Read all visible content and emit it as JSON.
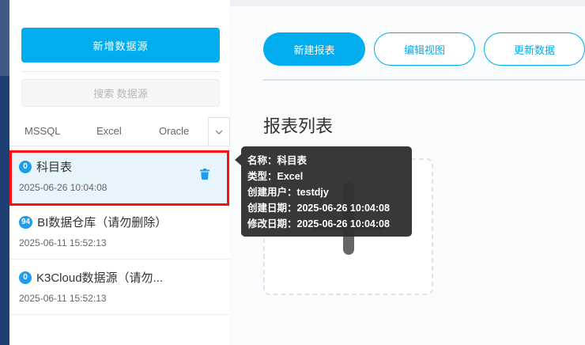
{
  "sidebar": {
    "add_button": "新增数据源",
    "search_placeholder": "搜索 数据源",
    "tabs": [
      "MSSQL",
      "Excel",
      "Oracle"
    ],
    "tab_more_icon": "chevron-down-icon",
    "items": [
      {
        "badge": "0",
        "name": "科目表",
        "date": "2025-06-26 10:04:08",
        "active": true
      },
      {
        "badge": "94",
        "name": "BI数据仓库（请勿删除）",
        "date": "2025-06-11 15:52:13",
        "active": false
      },
      {
        "badge": "0",
        "name": "K3Cloud数据源（请勿...",
        "date": "2025-06-11 15:52:13",
        "active": false
      }
    ]
  },
  "toolbar": {
    "new_report": "新建报表",
    "edit_view": "编辑视图",
    "update_data": "更新数据"
  },
  "main": {
    "section_title": "报表列表"
  },
  "tooltip": {
    "name": "名称：科目表",
    "type": "类型：Excel",
    "creator": "创建用户：testdjy",
    "created": "创建日期：2025-06-26 10:04:08",
    "modified": "修改日期：2025-06-26 10:04:08"
  },
  "colors": {
    "accent": "#00adef",
    "badge": "#1e9de8",
    "highlight": "#ff0f0f",
    "nav": "#1d3f73"
  }
}
